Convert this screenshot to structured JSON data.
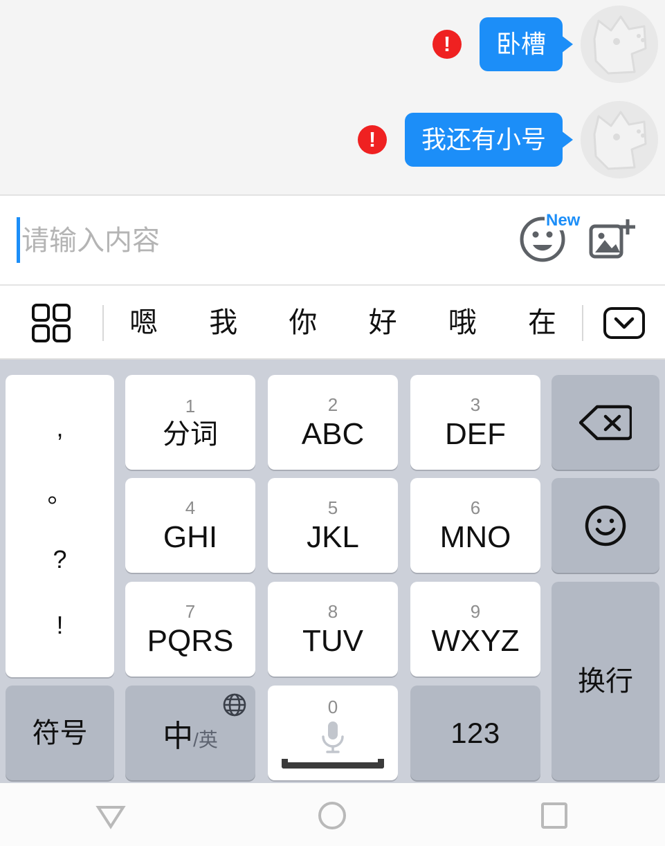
{
  "chat": {
    "messages": [
      {
        "text": "卧槽",
        "status_icon": "error-icon",
        "avatar": "cat-avatar"
      },
      {
        "text": "我还有小号",
        "status_icon": "error-icon",
        "avatar": "cat-avatar"
      }
    ],
    "error_glyph": "!"
  },
  "input": {
    "placeholder": "请输入内容",
    "value": "",
    "emoji_icon": "emoji-face-icon",
    "new_badge": "New",
    "image_icon": "add-image-icon"
  },
  "candidates": {
    "grid_icon": "grid-icon",
    "words": [
      "嗯",
      "我",
      "你",
      "好",
      "哦",
      "在"
    ],
    "collapse_icon": "chevron-down-icon"
  },
  "keyboard": {
    "punctuation": [
      ",",
      "。",
      "?",
      "!"
    ],
    "keys": [
      {
        "num": "1",
        "label": "分词"
      },
      {
        "num": "2",
        "label": "ABC"
      },
      {
        "num": "3",
        "label": "DEF"
      },
      {
        "num": "4",
        "label": "GHI"
      },
      {
        "num": "5",
        "label": "JKL"
      },
      {
        "num": "6",
        "label": "MNO"
      },
      {
        "num": "7",
        "label": "PQRS"
      },
      {
        "num": "8",
        "label": "TUV"
      },
      {
        "num": "9",
        "label": "WXYZ"
      }
    ],
    "backspace_icon": "backspace-icon",
    "emoji_icon": "smiley-icon",
    "enter_label": "换行",
    "symbols_label": "符号",
    "lang_label_primary": "中",
    "lang_label_secondary": "/英",
    "globe_icon": "globe-icon",
    "space_num": "0",
    "mic_icon": "microphone-icon",
    "numbers_label": "123"
  },
  "navbar": {
    "back_icon": "back-triangle-icon",
    "home_icon": "home-circle-icon",
    "recents_icon": "recents-square-icon"
  },
  "colors": {
    "bubble": "#1c8ef8",
    "error": "#ef2121",
    "accent": "#1c8ef8",
    "keyboard_bg": "#ccd0d9",
    "fn_key": "#b3b9c4"
  }
}
